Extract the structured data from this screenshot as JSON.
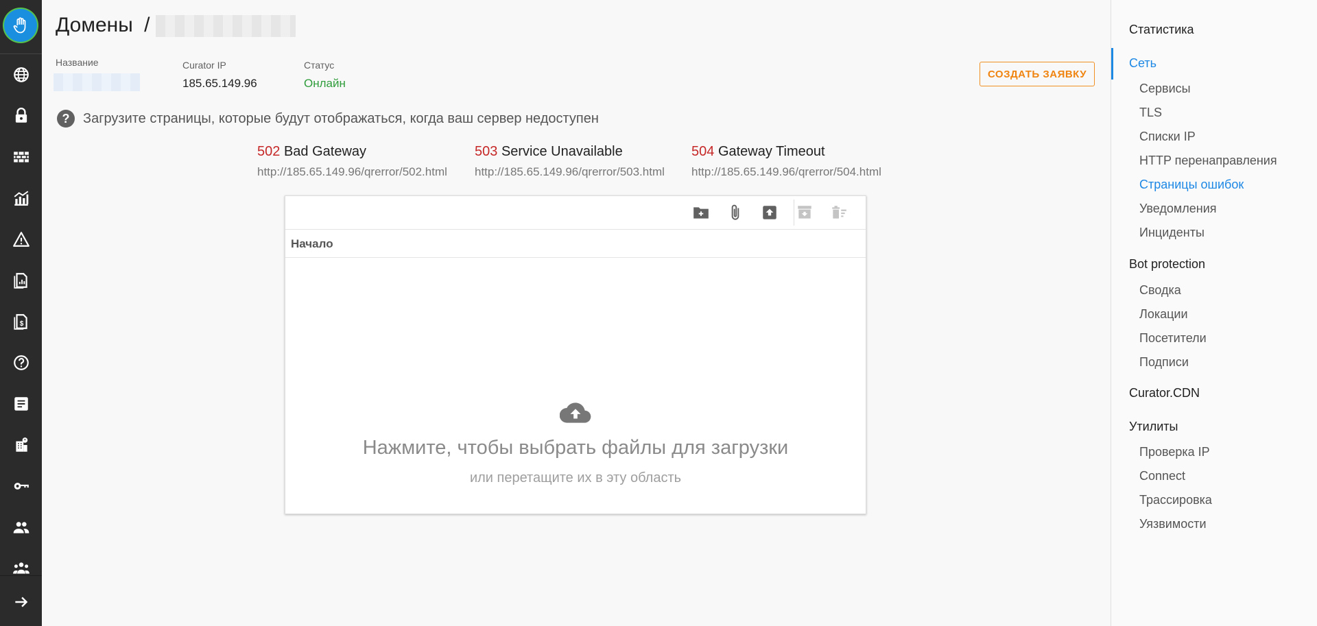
{
  "nav": {
    "logo_icon": "hand-icon",
    "items": [
      {
        "icon": "globe-icon"
      },
      {
        "icon": "lock-icon"
      },
      {
        "icon": "firewall-icon"
      },
      {
        "icon": "analytics-icon"
      },
      {
        "icon": "warning-icon"
      },
      {
        "icon": "report-icon"
      },
      {
        "icon": "billing-icon"
      },
      {
        "icon": "help-icon"
      },
      {
        "icon": "article-icon"
      },
      {
        "icon": "building-icon"
      },
      {
        "icon": "key-icon"
      },
      {
        "icon": "people-icon"
      },
      {
        "icon": "groups-icon"
      },
      {
        "icon": "arrow-right-icon"
      }
    ]
  },
  "header": {
    "title": "Домены",
    "separator": "/"
  },
  "info": {
    "name_label": "Название",
    "ip_label": "Curator IP",
    "ip_value": "185.65.149.96",
    "status_label": "Статус",
    "status_value": "Онлайн",
    "create_button": "СОЗДАТЬ ЗАЯВКУ"
  },
  "hint": {
    "text": "Загрузите страницы, которые будут отображаться, когда ваш сервер недоступен"
  },
  "errors": [
    {
      "code": "502",
      "name": "Bad Gateway",
      "url": "http://185.65.149.96/qrerror/502.html"
    },
    {
      "code": "503",
      "name": "Service Unavailable",
      "url": "http://185.65.149.96/qrerror/503.html"
    },
    {
      "code": "504",
      "name": "Gateway Timeout",
      "url": "http://185.65.149.96/qrerror/504.html"
    }
  ],
  "file_manager": {
    "toolbar_icons": [
      "new-folder-icon",
      "attach-icon",
      "upload-icon",
      "archive-icon",
      "delete-icon"
    ],
    "breadcrumb": "Начало",
    "drop_main": "Нажмите, чтобы выбрать файлы для загрузки",
    "drop_sub": "или перетащите их в эту область",
    "drop_icon": "cloud-upload-icon"
  },
  "sidebar": {
    "statistics": "Статистика",
    "network": "Сеть",
    "network_items": [
      "Сервисы",
      "TLS",
      "Списки IP",
      "HTTP перенаправления",
      "Страницы ошибок",
      "Уведомления",
      "Инциденты"
    ],
    "bot_protection": "Bot protection",
    "bot_items": [
      "Сводка",
      "Локации",
      "Посетители",
      "Подписи"
    ],
    "cdn": "Curator.CDN",
    "utilities": "Утилиты",
    "utility_items": [
      "Проверка IP",
      "Connect",
      "Трассировка",
      "Уязвимости"
    ],
    "accent_color": "#1e88e5"
  }
}
